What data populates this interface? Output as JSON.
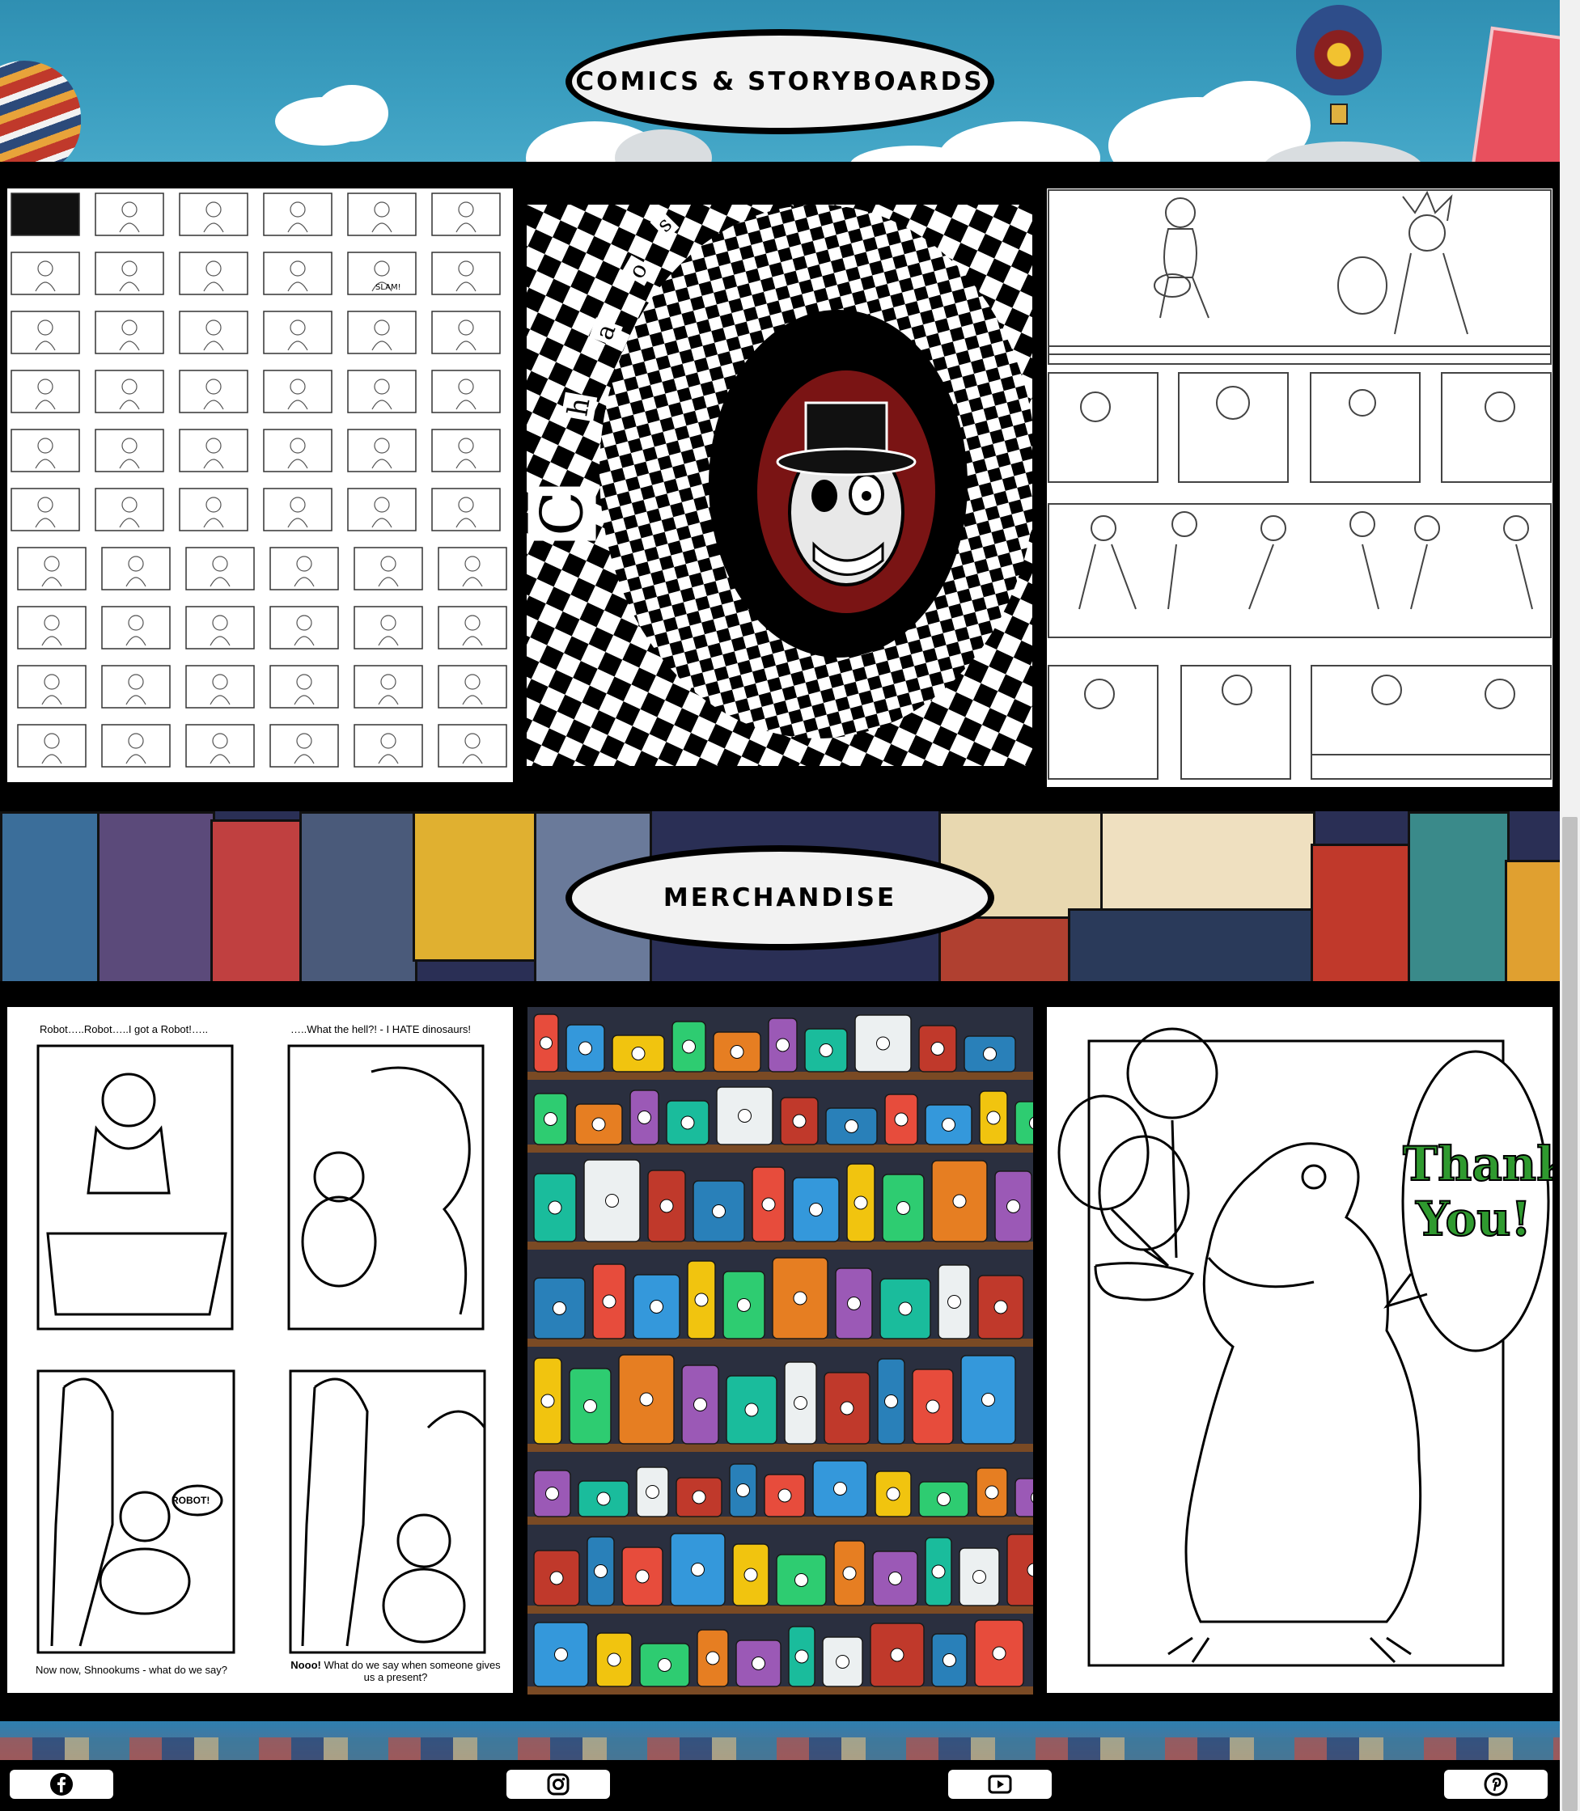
{
  "sections": {
    "comics": {
      "title": "COMICS & STORYBOARDS"
    },
    "merch": {
      "title": "MERCHANDISE"
    }
  },
  "panels": {
    "storyboard_slam": "SLAM!",
    "chaos_letters": [
      "C",
      "h",
      "a",
      "o",
      "s"
    ],
    "coloring": {
      "caption_top_left": "Robot…..Robot…..I got a Robot!…..",
      "caption_top_right": "…..What the hell?! - I HATE dinosaurs!",
      "bubble": "ROBOT!",
      "caption_bottom_left": "Now now, Shnookums - what do we say?",
      "caption_bottom_right_bold": "Nooo!",
      "caption_bottom_right": " What do we say when someone gives us a present?"
    },
    "thank_you": [
      "Thank",
      "You!"
    ]
  },
  "social": [
    {
      "name": "facebook",
      "icon": "facebook-icon"
    },
    {
      "name": "instagram",
      "icon": "instagram-icon"
    },
    {
      "name": "youtube",
      "icon": "youtube-icon"
    },
    {
      "name": "pinterest",
      "icon": "pinterest-icon"
    }
  ],
  "colors": {
    "sky": "#3b9ec0",
    "panel_black": "#000000",
    "thank_you_green": "#2f9a2f",
    "chaos_red": "#7a1414"
  }
}
